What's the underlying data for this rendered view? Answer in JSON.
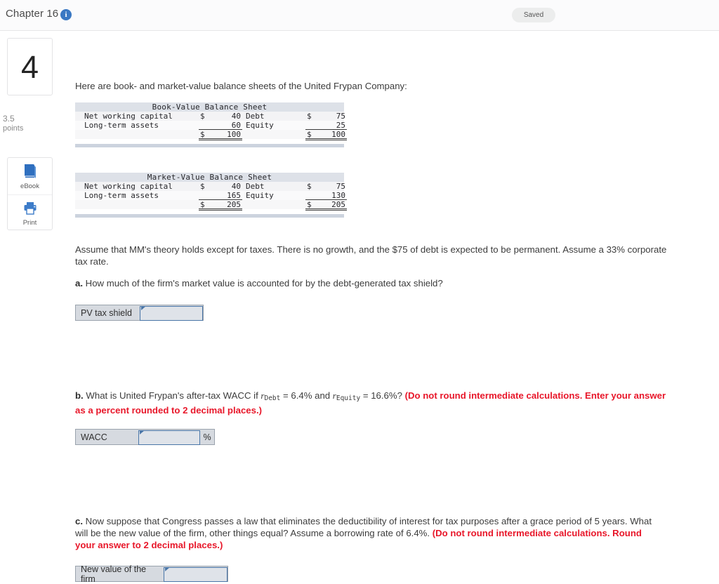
{
  "topbar": {
    "chapter": "Chapter 16",
    "info_icon": "info-icon",
    "saved_badge": "Saved"
  },
  "rail": {
    "question_number": "4",
    "points_value": "3.5",
    "points_label": "points",
    "tools": [
      {
        "icon": "ebook-icon",
        "label": "eBook"
      },
      {
        "icon": "printer-icon",
        "label": "Print"
      }
    ]
  },
  "main": {
    "intro": "Here are book- and market-value balance sheets of the United Frypan Company:",
    "assumption": "Assume that MM's theory holds except for taxes. There is no growth, and the $75 of debt is expected to be permanent. Assume a 33% corporate tax rate.",
    "questions": {
      "a": {
        "letter": "a.",
        "text": "How much of the firm's market value is accounted for by the debt-generated tax shield?",
        "field_label": "PV tax shield",
        "field_value": "",
        "field_suffix": ""
      },
      "b": {
        "letter": "b.",
        "text_1": "What is United Frypan's after-tax WACC if ",
        "r1_symbol": "r",
        "r1_sub": "Debt",
        "text_2": " = 6.4% and ",
        "r2_symbol": "r",
        "r2_sub": "Equity",
        "text_3": " = 16.6%? ",
        "red_note": "(Do not round intermediate calculations. Enter your answer as a percent rounded to 2 decimal places.)",
        "field_label": "WACC",
        "field_value": "",
        "field_suffix": "%"
      },
      "c": {
        "letter": "c.",
        "text": "Now suppose that Congress passes a law that eliminates the deductibility of interest for tax purposes after a grace period of 5 years. What will be the new value of the firm, other things equal? Assume a borrowing rate of 6.4%. ",
        "red_note": "(Do not round intermediate calculations. Round your answer to 2 decimal places.)",
        "field_label": "New value of the firm",
        "field_value": "",
        "field_suffix": ""
      }
    }
  },
  "tables": [
    {
      "title": "Book-Value Balance Sheet",
      "rows": [
        {
          "label": "Net working capital",
          "dollar": "$",
          "value": "40",
          "label2": "Debt",
          "dollar2": "$",
          "value2": "75"
        },
        {
          "label": "Long-term assets",
          "dollar": "",
          "value": "60",
          "label2": "Equity",
          "dollar2": "",
          "value2": "25"
        }
      ],
      "total": {
        "label": "",
        "dollar": "$",
        "value": "100",
        "label2": "",
        "dollar2": "$",
        "value2": "100"
      }
    },
    {
      "title": "Market-Value Balance Sheet",
      "rows": [
        {
          "label": "Net working capital",
          "dollar": "$",
          "value": "40",
          "label2": "Debt",
          "dollar2": "$",
          "value2": "75"
        },
        {
          "label": "Long-term assets",
          "dollar": "",
          "value": "165",
          "label2": "Equity",
          "dollar2": "",
          "value2": "130"
        }
      ],
      "total": {
        "label": "",
        "dollar": "$",
        "value": "205",
        "label2": "",
        "dollar2": "$",
        "value2": "205"
      }
    }
  ],
  "colors": {
    "accent_blue": "#3a78c3",
    "red_note": "#e8172a",
    "field_border": "#4a76a8",
    "table_header_bg": "#dde1e8"
  }
}
